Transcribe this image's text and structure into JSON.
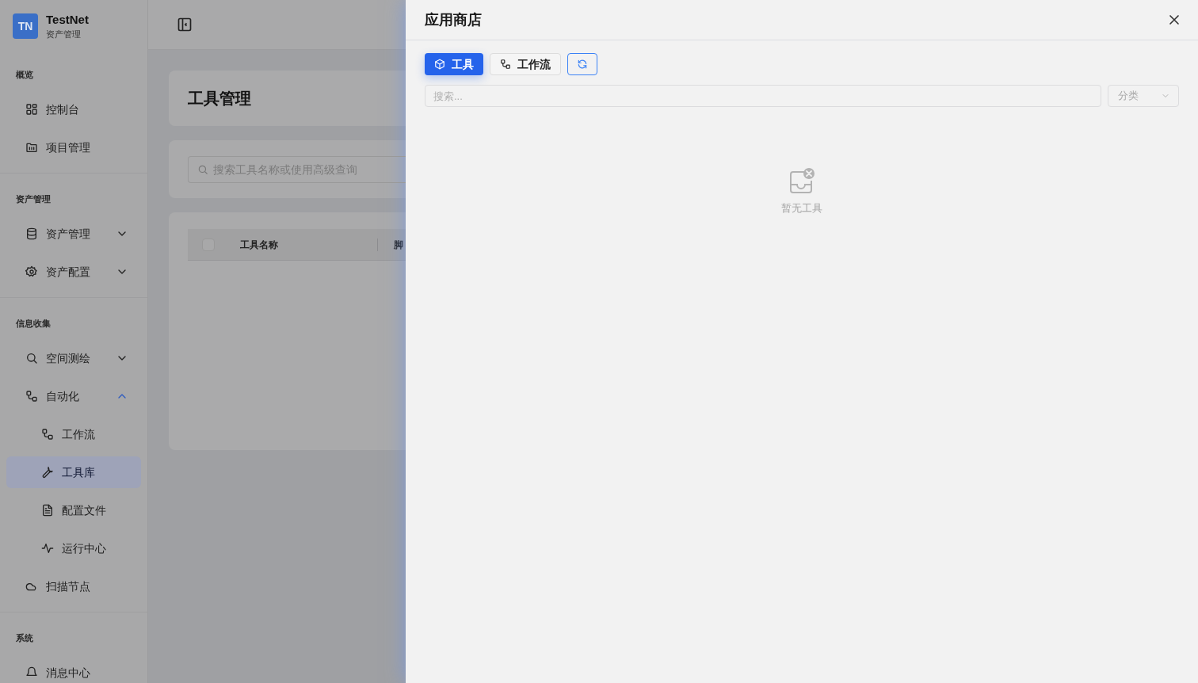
{
  "sidebar": {
    "brand": {
      "initials": "TN",
      "name": "TestNet",
      "subtitle": "资产管理"
    },
    "sections": [
      {
        "title": "概览",
        "items": [
          {
            "label": "控制台",
            "selected": false
          },
          {
            "label": "项目管理",
            "selected": false
          }
        ]
      },
      {
        "title": "资产管理",
        "items": [
          {
            "label": "资产管理",
            "selected": false,
            "expanded": false
          },
          {
            "label": "资产配置",
            "selected": false,
            "expanded": false
          }
        ]
      },
      {
        "title": "信息收集",
        "items": [
          {
            "label": "空间测绘",
            "selected": false,
            "expanded": false
          },
          {
            "label": "自动化",
            "selected": false,
            "expanded": true,
            "children": [
              {
                "label": "工作流",
                "selected": false
              },
              {
                "label": "工具库",
                "selected": true
              },
              {
                "label": "配置文件",
                "selected": false
              },
              {
                "label": "运行中心",
                "selected": false
              }
            ]
          },
          {
            "label": "扫描节点",
            "selected": false
          }
        ]
      },
      {
        "title": "系统",
        "items": [
          {
            "label": "消息中心",
            "selected": false
          }
        ]
      }
    ]
  },
  "main": {
    "page_title": "工具管理",
    "search": {
      "placeholder": "搜索工具名称或使用高级查询"
    },
    "table": {
      "select_all_checked": false,
      "columns": [
        "工具名称",
        "脚"
      ]
    }
  },
  "drawer": {
    "title": "应用商店",
    "tabs": [
      {
        "label": "工具",
        "selected": true
      },
      {
        "label": "工作流",
        "selected": false
      }
    ],
    "search": {
      "placeholder": "搜索..."
    },
    "category": {
      "placeholder": "分类"
    },
    "empty_text": "暂无工具"
  }
}
